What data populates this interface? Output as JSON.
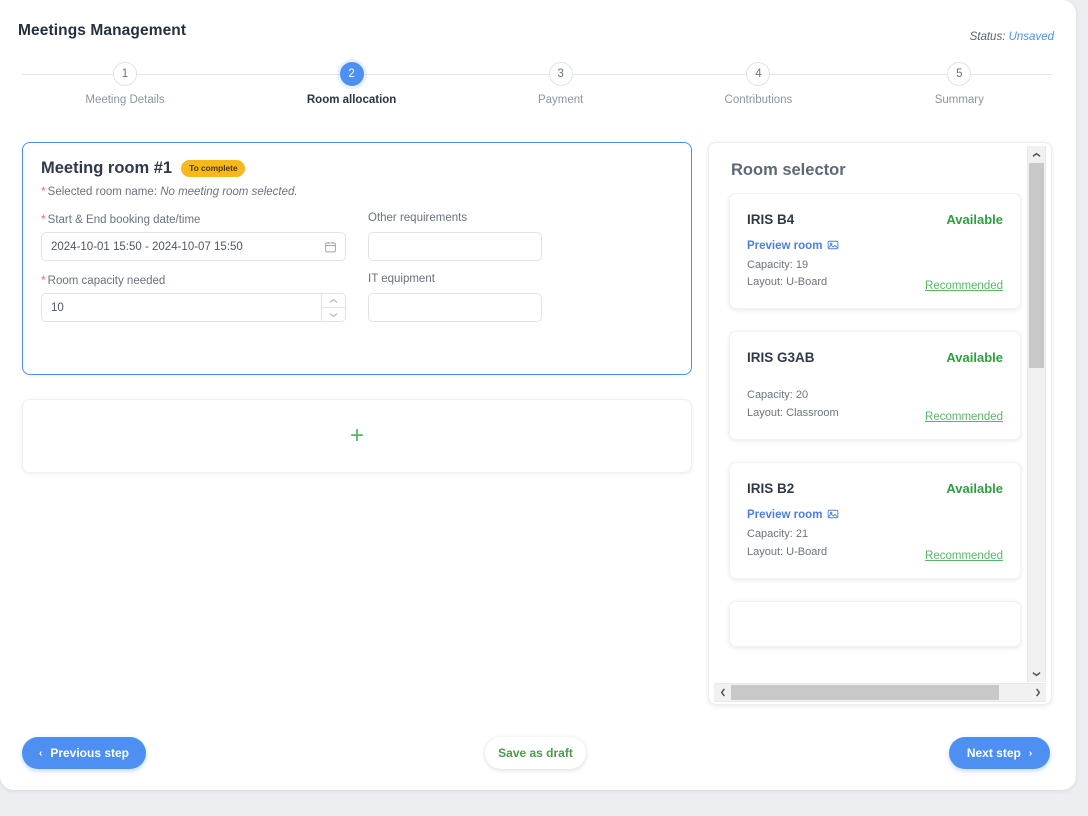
{
  "header": {
    "title": "Meetings Management",
    "status_label": "Status:",
    "status_value": "Unsaved"
  },
  "stepper": {
    "current": 2,
    "steps": [
      {
        "number": "1",
        "label": "Meeting Details"
      },
      {
        "number": "2",
        "label": "Room allocation"
      },
      {
        "number": "3",
        "label": "Payment"
      },
      {
        "number": "4",
        "label": "Contributions"
      },
      {
        "number": "5",
        "label": "Summary"
      }
    ]
  },
  "room_form": {
    "title": "Meeting room #1",
    "badge": "To complete",
    "selected_room_label": "Selected room name:",
    "selected_room_value": "No meeting room selected.",
    "required_marker": "*",
    "fields": {
      "booking_datetime": {
        "label": "Start & End booking date/time",
        "value": "2024-10-01 15:50 - 2024-10-07 15:50",
        "icon": "calendar-icon"
      },
      "capacity": {
        "label": "Room capacity needed",
        "value": "10"
      },
      "other_requirements": {
        "label": "Other requirements",
        "value": "",
        "placeholder": ""
      },
      "it_equipment": {
        "label": "IT equipment",
        "value": "",
        "placeholder": ""
      }
    }
  },
  "add_room_card": {
    "icon": "plus-icon",
    "icon_glyph": "+"
  },
  "room_selector": {
    "title": "Room selector",
    "preview_label": "Preview room",
    "capacity_prefix": "Capacity: ",
    "layout_prefix": "Layout: ",
    "recommended_label": "Recommended",
    "rooms": [
      {
        "name": "IRIS B4",
        "status": "Available",
        "has_preview": true,
        "capacity": "19",
        "layout": "U-Board",
        "recommended": true
      },
      {
        "name": "IRIS G3AB",
        "status": "Available",
        "has_preview": false,
        "capacity": "20",
        "layout": "Classroom",
        "recommended": true
      },
      {
        "name": "IRIS B2",
        "status": "Available",
        "has_preview": true,
        "capacity": "21",
        "layout": "U-Board",
        "recommended": true
      }
    ]
  },
  "footer": {
    "previous_label": "Previous step",
    "previous_chevron": "‹",
    "draft_label": "Save as draft",
    "next_label": "Next step",
    "next_chevron": "›"
  },
  "colors": {
    "accent_blue": "#4d90f2",
    "badge_amber": "#f5b91c",
    "available_green": "#2f9e41",
    "recommended_green": "#59b768",
    "required_red": "#f2667f",
    "page_bg": "#eceef1"
  }
}
